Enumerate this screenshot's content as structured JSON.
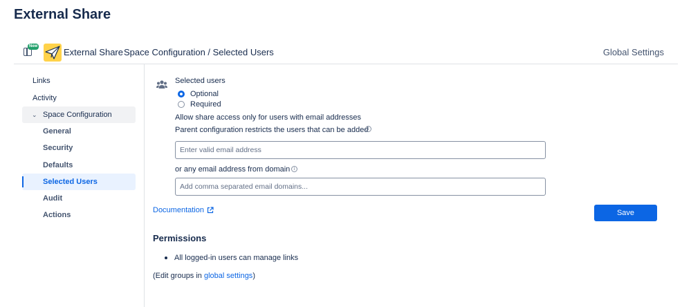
{
  "page": {
    "title": "External Share"
  },
  "header": {
    "badge": "New",
    "app_name": "External Share",
    "breadcrumb": "Space Configuration / Selected Users",
    "global_settings": "Global Settings"
  },
  "sidebar": {
    "items": [
      {
        "label": "Links"
      },
      {
        "label": "Activity"
      },
      {
        "label": "Space Configuration"
      },
      {
        "label": "General"
      },
      {
        "label": "Security"
      },
      {
        "label": "Defaults"
      },
      {
        "label": "Selected Users"
      },
      {
        "label": "Audit"
      },
      {
        "label": "Actions"
      }
    ]
  },
  "form": {
    "section_label": "Selected users",
    "options": [
      {
        "label": "Optional",
        "checked": true
      },
      {
        "label": "Required",
        "checked": false
      }
    ],
    "restriction_note": "Allow share access only for users with email addresses",
    "parent_note": "Parent configuration restricts the users that can be added",
    "email_input": {
      "placeholder": "Enter valid email address",
      "value": ""
    },
    "domain_label": "or any email address from domain",
    "domain_input": {
      "placeholder": "Add comma separated email domains...",
      "value": ""
    },
    "documentation": "Documentation",
    "save": "Save"
  },
  "permissions": {
    "title": "Permissions",
    "items": [
      "All logged-in users can manage links"
    ],
    "edit_prefix": "(Edit groups in ",
    "edit_link": "global settings",
    "edit_suffix": ")"
  },
  "colors": {
    "accent": "#0c66e4",
    "badge": "#22a06b",
    "logo": "#ffd24a"
  }
}
